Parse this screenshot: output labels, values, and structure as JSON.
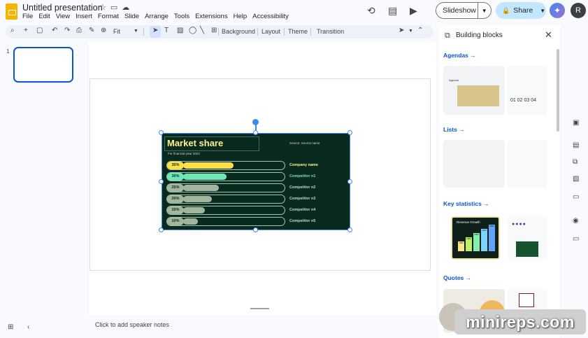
{
  "app": {
    "title": "Untitled presentation",
    "menu": [
      "File",
      "Edit",
      "View",
      "Insert",
      "Format",
      "Slide",
      "Arrange",
      "Tools",
      "Extensions",
      "Help",
      "Accessibility"
    ],
    "slideshow_label": "Slideshow",
    "share_label": "Share",
    "avatar_initial": "R"
  },
  "toolbar": {
    "zoom": "Fit",
    "background_label": "Background",
    "layout_label": "Layout",
    "theme_label": "Theme",
    "transition_label": "Transition"
  },
  "filmstrip": {
    "slide_number": "1"
  },
  "slide": {
    "speaker_notes_placeholder": "Click to add speaker notes"
  },
  "chart_data": {
    "type": "bar",
    "title": "Market share",
    "subtitle": "For financial year 2023",
    "source": "Source: Source name",
    "categories": [
      "Company name",
      "Competitor n1",
      "Competitor n2",
      "Competitor n3",
      "Competitor n4",
      "Competitor n5"
    ],
    "values": [
      35,
      30,
      25,
      20,
      15,
      10
    ],
    "value_labels": [
      "35%",
      "30%",
      "25%",
      "20%",
      "15%",
      "10%"
    ],
    "xlim": [
      0,
      70
    ],
    "colors": [
      "#fde047",
      "#6ee7b7",
      "#a3b59c",
      "#a3b59c",
      "#a3b59c",
      "#a3b59c"
    ],
    "label_colors": [
      "#fef08a",
      "#6ee7b7",
      "#cbd5c0",
      "#cbd5c0",
      "#cbd5c0",
      "#cbd5c0"
    ]
  },
  "panel": {
    "title": "Building blocks",
    "sections": [
      {
        "label": "Agendas"
      },
      {
        "label": "Lists"
      },
      {
        "label": "Key statistics"
      },
      {
        "label": "Quotes"
      }
    ],
    "agenda_preview": {
      "heading": "Agenda",
      "numbers": [
        "01",
        "02",
        "03",
        "04"
      ]
    },
    "stats_preview": {
      "heading": "Revenue Growth",
      "values": [
        "1000",
        "2000",
        "3000",
        "4000",
        "5000"
      ]
    }
  },
  "watermark": "minireps.com"
}
